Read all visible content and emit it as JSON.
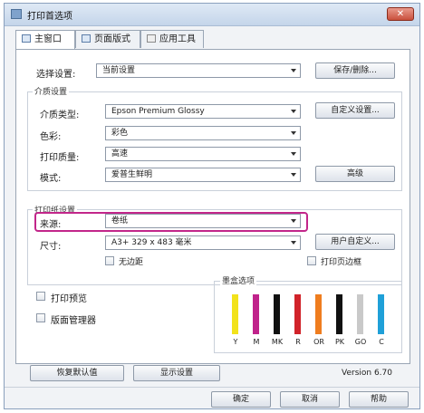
{
  "window": {
    "title": "打印首选项",
    "close_label": "✕"
  },
  "tabs": [
    {
      "label": "主窗口",
      "icon": "printer-icon"
    },
    {
      "label": "页面版式",
      "icon": "page-layout-icon"
    },
    {
      "label": "应用工具",
      "icon": "utility-icon"
    }
  ],
  "select_setting": {
    "label": "选择设置:",
    "value": "当前设置",
    "save_delete": "保存/删除..."
  },
  "media": {
    "group_title": "介质设置",
    "type_label": "介质类型:",
    "type_value": "Epson Premium Glossy",
    "custom_button": "自定义设置...",
    "color_label": "色彩:",
    "color_value": "彩色",
    "quality_label": "打印质量:",
    "quality_value": "高速",
    "mode_label": "模式:",
    "mode_value": "爱普生鲜明",
    "advanced_button": "高级"
  },
  "paper": {
    "group_title": "打印纸设置",
    "source_label": "来源:",
    "source_value": "卷纸",
    "size_label": "尺寸:",
    "size_value": "A3+ 329 x 483 毫米",
    "user_defined_button": "用户自定义...",
    "borderless_label": "无边距",
    "print_frame_label": "打印页边框"
  },
  "options": {
    "print_preview": "打印预览",
    "layout_manager": "版面管理器"
  },
  "ink": {
    "title": "墨盒选项",
    "cartridges": [
      {
        "name": "Y",
        "color": "#f2e21b"
      },
      {
        "name": "M",
        "color": "#c0238b"
      },
      {
        "name": "MK",
        "color": "#111111"
      },
      {
        "name": "R",
        "color": "#d1232a"
      },
      {
        "name": "OR",
        "color": "#ef7d1f"
      },
      {
        "name": "PK",
        "color": "#111111"
      },
      {
        "name": "GO",
        "color": "#c9c9c9"
      },
      {
        "name": "C",
        "color": "#1fa0d8"
      }
    ]
  },
  "bottom": {
    "restore_defaults": "恢复默认值",
    "show_settings": "显示设置",
    "version": "Version 6.70"
  },
  "dialog_buttons": {
    "ok": "确定",
    "cancel": "取消",
    "help": "帮助"
  }
}
